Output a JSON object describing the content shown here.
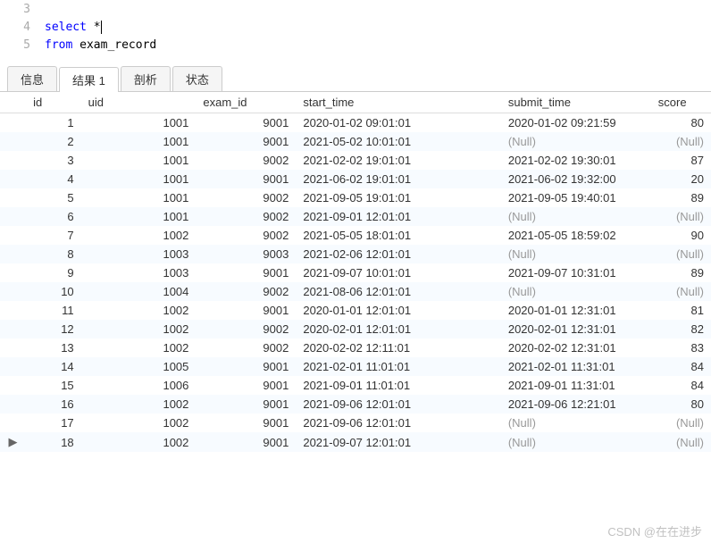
{
  "code": {
    "lines": [
      {
        "num": "3",
        "segments": []
      },
      {
        "num": "4",
        "segments": [
          {
            "t": "select ",
            "c": "kw"
          },
          {
            "t": "*",
            "c": "plain"
          }
        ],
        "caret": true
      },
      {
        "num": "5",
        "segments": [
          {
            "t": "from ",
            "c": "kw"
          },
          {
            "t": "exam_record",
            "c": "plain"
          }
        ]
      }
    ]
  },
  "tabs": {
    "items": [
      {
        "label": "信息",
        "active": false
      },
      {
        "label": "结果 1",
        "active": true
      },
      {
        "label": "剖析",
        "active": false
      },
      {
        "label": "状态",
        "active": false
      }
    ]
  },
  "table": {
    "columns": [
      "id",
      "uid",
      "exam_id",
      "start_time",
      "submit_time",
      "score"
    ],
    "rows": [
      {
        "mark": "",
        "id": "1",
        "uid": "1001",
        "exam_id": "9001",
        "start_time": "2020-01-02 09:01:01",
        "submit_time": "2020-01-02 09:21:59",
        "score": "80"
      },
      {
        "mark": "",
        "id": "2",
        "uid": "1001",
        "exam_id": "9001",
        "start_time": "2021-05-02 10:01:01",
        "submit_time": null,
        "score": null
      },
      {
        "mark": "",
        "id": "3",
        "uid": "1001",
        "exam_id": "9002",
        "start_time": "2021-02-02 19:01:01",
        "submit_time": "2021-02-02 19:30:01",
        "score": "87"
      },
      {
        "mark": "",
        "id": "4",
        "uid": "1001",
        "exam_id": "9001",
        "start_time": "2021-06-02 19:01:01",
        "submit_time": "2021-06-02 19:32:00",
        "score": "20"
      },
      {
        "mark": "",
        "id": "5",
        "uid": "1001",
        "exam_id": "9002",
        "start_time": "2021-09-05 19:01:01",
        "submit_time": "2021-09-05 19:40:01",
        "score": "89"
      },
      {
        "mark": "",
        "id": "6",
        "uid": "1001",
        "exam_id": "9002",
        "start_time": "2021-09-01 12:01:01",
        "submit_time": null,
        "score": null
      },
      {
        "mark": "",
        "id": "7",
        "uid": "1002",
        "exam_id": "9002",
        "start_time": "2021-05-05 18:01:01",
        "submit_time": "2021-05-05 18:59:02",
        "score": "90"
      },
      {
        "mark": "",
        "id": "8",
        "uid": "1003",
        "exam_id": "9003",
        "start_time": "2021-02-06 12:01:01",
        "submit_time": null,
        "score": null
      },
      {
        "mark": "",
        "id": "9",
        "uid": "1003",
        "exam_id": "9001",
        "start_time": "2021-09-07 10:01:01",
        "submit_time": "2021-09-07 10:31:01",
        "score": "89"
      },
      {
        "mark": "",
        "id": "10",
        "uid": "1004",
        "exam_id": "9002",
        "start_time": "2021-08-06 12:01:01",
        "submit_time": null,
        "score": null
      },
      {
        "mark": "",
        "id": "11",
        "uid": "1002",
        "exam_id": "9001",
        "start_time": "2020-01-01 12:01:01",
        "submit_time": "2020-01-01 12:31:01",
        "score": "81"
      },
      {
        "mark": "",
        "id": "12",
        "uid": "1002",
        "exam_id": "9002",
        "start_time": "2020-02-01 12:01:01",
        "submit_time": "2020-02-01 12:31:01",
        "score": "82"
      },
      {
        "mark": "",
        "id": "13",
        "uid": "1002",
        "exam_id": "9002",
        "start_time": "2020-02-02 12:11:01",
        "submit_time": "2020-02-02 12:31:01",
        "score": "83"
      },
      {
        "mark": "",
        "id": "14",
        "uid": "1005",
        "exam_id": "9001",
        "start_time": "2021-02-01 11:01:01",
        "submit_time": "2021-02-01 11:31:01",
        "score": "84"
      },
      {
        "mark": "",
        "id": "15",
        "uid": "1006",
        "exam_id": "9001",
        "start_time": "2021-09-01 11:01:01",
        "submit_time": "2021-09-01 11:31:01",
        "score": "84"
      },
      {
        "mark": "",
        "id": "16",
        "uid": "1002",
        "exam_id": "9001",
        "start_time": "2021-09-06 12:01:01",
        "submit_time": "2021-09-06 12:21:01",
        "score": "80"
      },
      {
        "mark": "",
        "id": "17",
        "uid": "1002",
        "exam_id": "9001",
        "start_time": "2021-09-06 12:01:01",
        "submit_time": null,
        "score": null
      },
      {
        "mark": "▶",
        "id": "18",
        "uid": "1002",
        "exam_id": "9001",
        "start_time": "2021-09-07 12:01:01",
        "submit_time": null,
        "score": null
      }
    ],
    "null_text": "(Null)"
  },
  "watermark": "CSDN @在在进步"
}
